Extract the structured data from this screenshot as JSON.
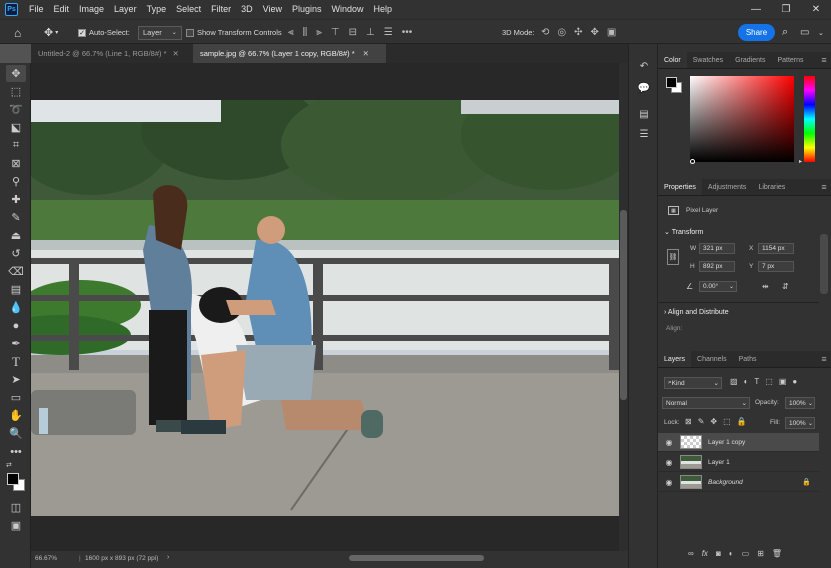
{
  "app": {
    "logo": "Ps"
  },
  "menu": [
    "File",
    "Edit",
    "Image",
    "Layer",
    "Type",
    "Select",
    "Filter",
    "3D",
    "View",
    "Plugins",
    "Window",
    "Help"
  ],
  "options": {
    "auto_select_label": "Auto-Select:",
    "auto_select_target": "Layer",
    "show_transform_label": "Show Transform Controls",
    "mode_3d_label": "3D Mode:",
    "share_label": "Share"
  },
  "tabs": [
    {
      "label": "Untitled-2 @ 66.7% (Line 1, RGB/8#) *",
      "active": false
    },
    {
      "label": "sample.jpg @ 66.7% (Layer 1 copy, RGB/8#) *",
      "active": true
    }
  ],
  "status": {
    "zoom": "66.67%",
    "doc_info": "1600 px x 893 px (72 ppi)"
  },
  "color_panel": {
    "tabs": [
      "Color",
      "Swatches",
      "Gradients",
      "Patterns"
    ],
    "active": "Color"
  },
  "properties_panel": {
    "tabs": [
      "Properties",
      "Adjustments",
      "Libraries"
    ],
    "active": "Properties",
    "layer_type": "Pixel Layer",
    "transform_heading": "Transform",
    "w_label": "W",
    "w_value": "321 px",
    "x_label": "X",
    "x_value": "1154 px",
    "h_label": "H",
    "h_value": "892 px",
    "y_label": "Y",
    "y_value": "7 px",
    "angle_value": "0.00°",
    "align_heading": "Align and Distribute",
    "align_label": "Align:"
  },
  "layers_panel": {
    "tabs": [
      "Layers",
      "Channels",
      "Paths"
    ],
    "active": "Layers",
    "filter_kind": "Kind",
    "blend_mode": "Normal",
    "opacity_label": "Opacity:",
    "opacity_value": "100%",
    "lock_label": "Lock:",
    "fill_label": "Fill:",
    "fill_value": "100%",
    "layers": [
      {
        "name": "Layer 1 copy",
        "selected": true
      },
      {
        "name": "Layer 1",
        "selected": false
      },
      {
        "name": "Background",
        "selected": false,
        "locked": true
      }
    ]
  },
  "colors": {
    "accent": "#1473e6",
    "ui_dark": "#323232",
    "ui_darker": "#282828"
  }
}
